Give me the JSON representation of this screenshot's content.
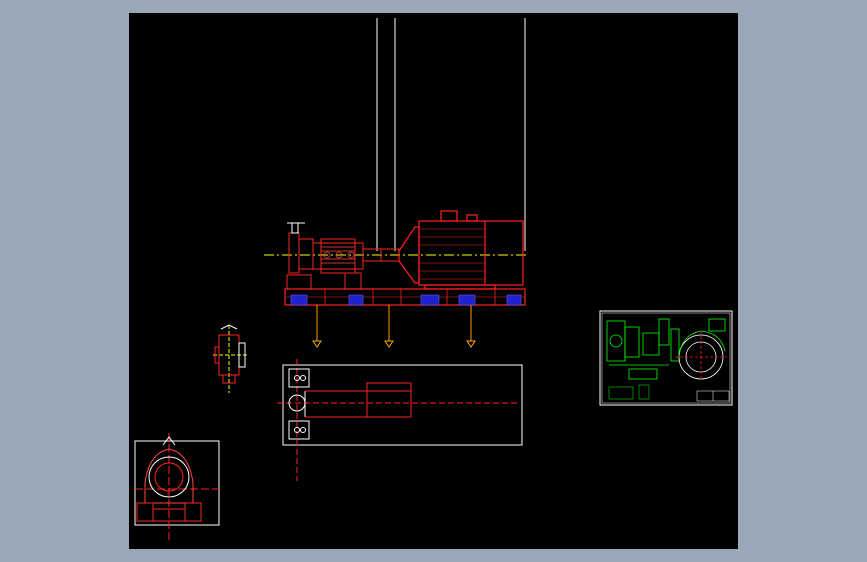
{
  "viewer": {
    "background_color": "#9aa7b7",
    "canvas_color": "#000000"
  },
  "drawing": {
    "line_colors": {
      "outline": "#ffffff",
      "equipment": "#ff0000",
      "centerline": "#ffff00",
      "detail": "#ff3333",
      "hatch": "#00ff00",
      "base_fill": "#2222cc",
      "motor": "#ff2222"
    },
    "views": [
      {
        "name": "elevation-view",
        "subject": "pump-motor-assembly-on-baseplate"
      },
      {
        "name": "plan-view",
        "subject": "baseplate-outline"
      },
      {
        "name": "end-view",
        "subject": "pump-end-elevation"
      },
      {
        "name": "small-pump-view",
        "subject": "pump-side-detail"
      },
      {
        "name": "detail-sheet",
        "subject": "pump-section-drawing"
      }
    ]
  }
}
